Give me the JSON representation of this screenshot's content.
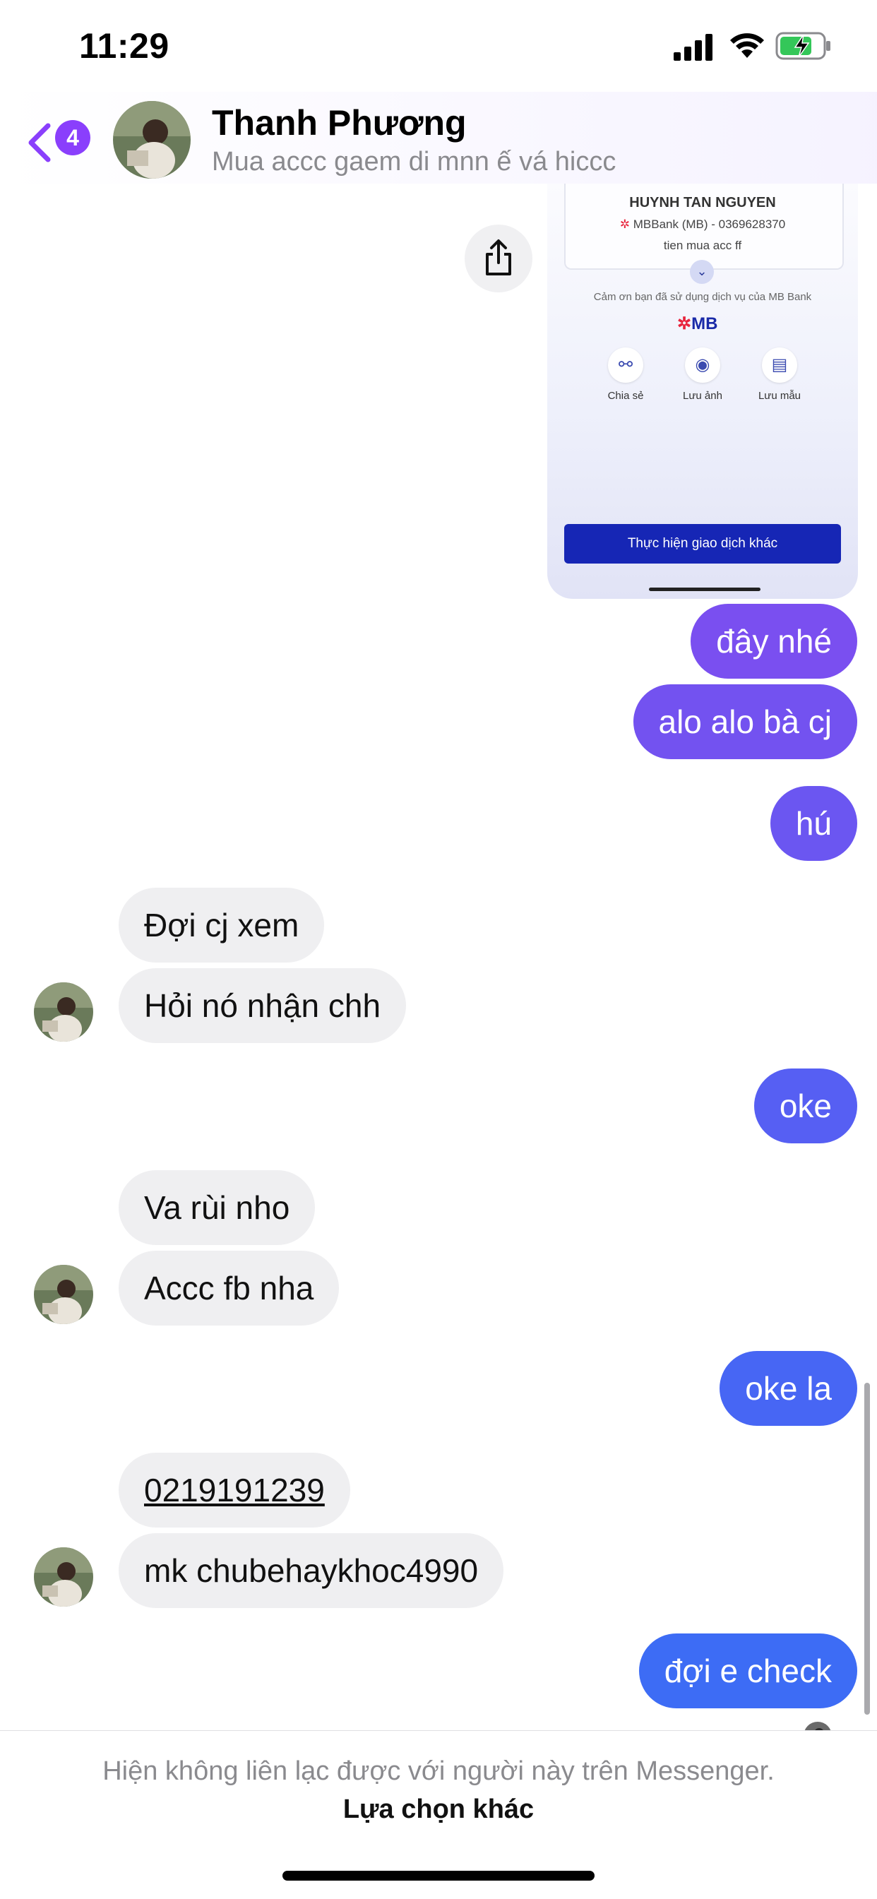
{
  "status_bar": {
    "time": "11:29",
    "battery_state": "charging"
  },
  "header": {
    "back_badge": "4",
    "contact_name": "Thanh Phương",
    "contact_subtitle": "Mua accc gaem di mnn ế vá hiccc"
  },
  "receipt": {
    "recipient": "HUYNH TAN NGUYEN",
    "bank_line": "MBBank (MB) - 0369628370",
    "note": "tien mua acc ff",
    "thanks": "Cảm ơn bạn đã sử dụng dịch vụ của MB Bank",
    "logo": "MB",
    "actions": [
      {
        "label": "Chia sẻ",
        "icon": "share-nodes-icon"
      },
      {
        "label": "Lưu ảnh",
        "icon": "camera-icon"
      },
      {
        "label": "Lưu mẫu",
        "icon": "template-icon"
      }
    ],
    "button": "Thực hiện giao dịch khác"
  },
  "messages": [
    {
      "side": "out",
      "text": "đây nhé"
    },
    {
      "side": "out",
      "text": "alo alo bà cj"
    },
    {
      "side": "out",
      "text": "hú"
    },
    {
      "side": "in",
      "text": "Đợi cj xem"
    },
    {
      "side": "in",
      "text": "Hỏi nó nhận chh"
    },
    {
      "side": "out",
      "text": "oke"
    },
    {
      "side": "in",
      "text": "Va rùi nho"
    },
    {
      "side": "in",
      "text": "Accc fb nha"
    },
    {
      "side": "out",
      "text": "oke la"
    },
    {
      "side": "in",
      "text": "0219191239"
    },
    {
      "side": "in",
      "text": "mk chubehaykhoc4990"
    },
    {
      "side": "out",
      "text": "đợi e check"
    }
  ],
  "footer": {
    "notice": "Hiện không liên lạc được với người này trên Messenger.",
    "action": "Lựa chọn khác"
  },
  "colors": {
    "accent_purple": "#8a3ffc",
    "outgoing_top": "#7b4ff0",
    "outgoing_bottom": "#3d6cf5",
    "incoming_bg": "#efeff1",
    "mb_blue": "#1626b5"
  }
}
